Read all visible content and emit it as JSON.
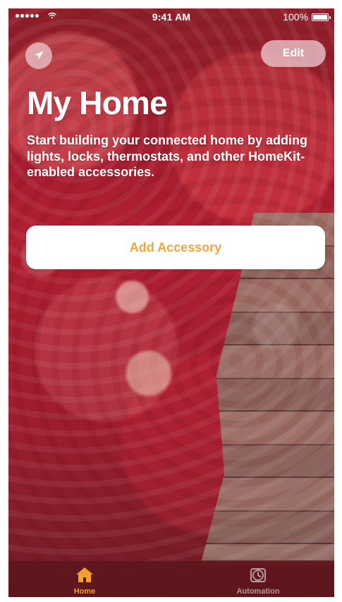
{
  "status_bar": {
    "time": "9:41 AM",
    "battery": "100%"
  },
  "toolbar": {
    "edit_label": "Edit"
  },
  "main": {
    "title": "My Home",
    "description": "Start building your connected home by adding lights, locks, thermostats, and other HomeKit-enabled accessories.",
    "add_accessory_label": "Add Accessory"
  },
  "tab_bar": {
    "items": [
      {
        "label": "Home",
        "icon": "home-icon"
      },
      {
        "label": "Automation",
        "icon": "clock-icon"
      }
    ]
  },
  "colors": {
    "accent": "#f2a12f",
    "tab_inactive": "#b59b9f",
    "button_text": "#f1a53d"
  }
}
